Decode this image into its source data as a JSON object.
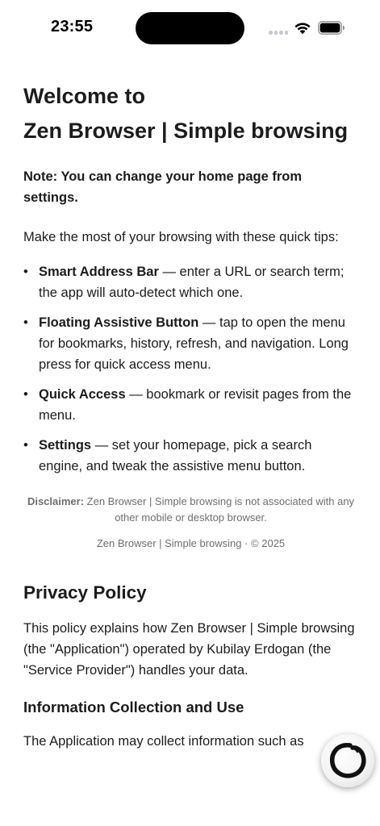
{
  "status_bar": {
    "time": "23:55"
  },
  "welcome": {
    "title_line1": "Welcome to",
    "title_line2": "Zen Browser | Simple browsing",
    "note": "Note: You can change your home page from settings.",
    "intro": "Make the most of your browsing with these quick tips:",
    "tips": [
      {
        "title": "Smart Address Bar",
        "text": " — enter a URL or search term; the app will auto-detect which one."
      },
      {
        "title": "Floating Assistive Button",
        "text": " — tap to open the menu for bookmarks, history, refresh, and navigation. Long press for quick access menu."
      },
      {
        "title": "Quick Access",
        "text": " — bookmark or revisit pages from the menu."
      },
      {
        "title": "Settings",
        "text": " — set your homepage, pick a search engine, and tweak the assistive menu button."
      }
    ],
    "disclaimer_label": "Disclaimer:",
    "disclaimer_text": " Zen Browser | Simple browsing is not associated with any other mobile or desktop browser.",
    "copyright": "Zen Browser | Simple browsing · © 2025"
  },
  "privacy": {
    "title": "Privacy Policy",
    "text": "This policy explains how Zen Browser | Simple browsing (the \"Application\") operated by Kubilay Erdogan (the \"Service Provider\") handles your data.",
    "info_title": "Information Collection and Use",
    "info_text": "The Application may collect information such as"
  },
  "icons": {
    "wifi": "wifi-icon",
    "battery": "battery-icon",
    "assistive": "zen-circle-icon"
  }
}
